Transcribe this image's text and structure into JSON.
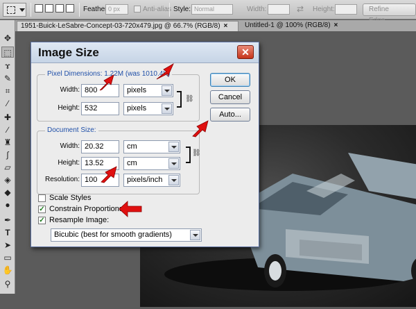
{
  "options_bar": {
    "feather_label": "Feather:",
    "feather_value": "0 px",
    "antialias_label": "Anti-alias",
    "style_label": "Style:",
    "style_value": "Normal",
    "width_label": "Width:",
    "height_label": "Height:",
    "refine_edge_label": "Refine Edge..."
  },
  "tabs": [
    {
      "label": "1951-Buick-LeSabre-Concept-03-720x479.jpg @ 66.7% (RGB/8)",
      "close": "×"
    },
    {
      "label": "Untitled-1 @ 100% (RGB/8)",
      "close": "×"
    }
  ],
  "dialog": {
    "title": "Image Size",
    "close_label": "✕",
    "pixel_dimensions": {
      "title": "Pixel Dimensions: 1.22M (was 1010.4K)",
      "width_label": "Width:",
      "width_value": "800",
      "width_unit": "pixels",
      "height_label": "Height:",
      "height_value": "532",
      "height_unit": "pixels"
    },
    "document_size": {
      "title": "Document Size:",
      "width_label": "Width:",
      "width_value": "20.32",
      "width_unit": "cm",
      "height_label": "Height:",
      "height_value": "13.52",
      "height_unit": "cm",
      "resolution_label": "Resolution:",
      "resolution_value": "100",
      "resolution_unit": "pixels/inch"
    },
    "buttons": {
      "ok": "OK",
      "cancel": "Cancel",
      "auto": "Auto..."
    },
    "options": {
      "scale_styles_label": "Scale Styles",
      "scale_styles_checked": false,
      "constrain_label": "Constrain Proportions",
      "constrain_checked": true,
      "resample_label": "Resample Image:",
      "resample_checked": true,
      "resample_method": "Bicubic (best for smooth gradients)"
    },
    "check_glyph": "✓"
  },
  "colors": {
    "accent_group_title": "#1f4fa8",
    "arrow_red": "#e01010",
    "close_red": "#c6341b"
  }
}
